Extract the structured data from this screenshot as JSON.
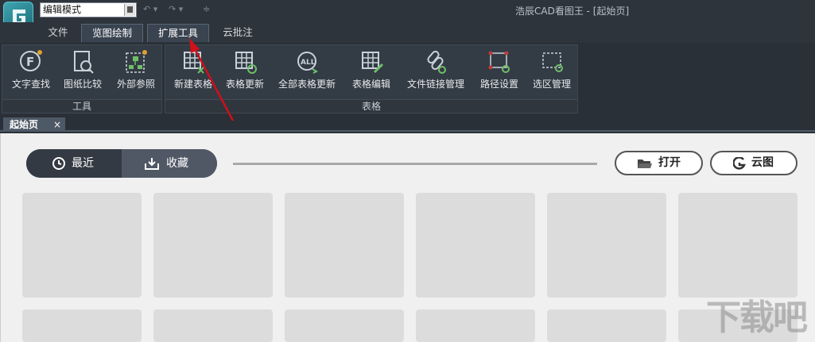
{
  "titlebar": {
    "mode_value": "编辑模式",
    "window_title": "浩辰CAD看图王 - [起始页]",
    "qa_undo": "↶ ▾",
    "qa_redo": "↷ ▾",
    "qa_more": "≑"
  },
  "tabs": [
    {
      "label": "文件"
    },
    {
      "label": "览图绘制"
    },
    {
      "label": "扩展工具"
    },
    {
      "label": "云批注"
    }
  ],
  "ribbon": {
    "tools_group": {
      "label": "工具",
      "buttons": [
        {
          "label": "文字查找",
          "icon": "text-search-icon"
        },
        {
          "label": "图纸比较",
          "icon": "drawing-compare-icon"
        },
        {
          "label": "外部参照",
          "icon": "xref-icon"
        }
      ]
    },
    "table_group": {
      "label": "表格",
      "buttons": [
        {
          "label": "新建表格",
          "icon": "new-table-icon"
        },
        {
          "label": "表格更新",
          "icon": "table-update-icon"
        },
        {
          "label": "全部表格更新",
          "icon": "update-all-icon"
        },
        {
          "label": "表格编辑",
          "icon": "table-edit-icon"
        },
        {
          "label": "文件链接管理",
          "icon": "link-manage-icon"
        },
        {
          "label": "路径设置",
          "icon": "path-settings-icon"
        },
        {
          "label": "选区管理",
          "icon": "selection-manage-icon"
        }
      ]
    }
  },
  "doc_tab": {
    "label": "起始页",
    "close": "×"
  },
  "start_page": {
    "recent_label": "最近",
    "favorites_label": "收藏",
    "open_label": "打开",
    "cloud_label": "云图"
  },
  "watermark": "下载吧",
  "colors": {
    "arrow": "#d0101a",
    "icon_accent": "#6fbf6a",
    "active_tab_bg": "#3a4350"
  }
}
